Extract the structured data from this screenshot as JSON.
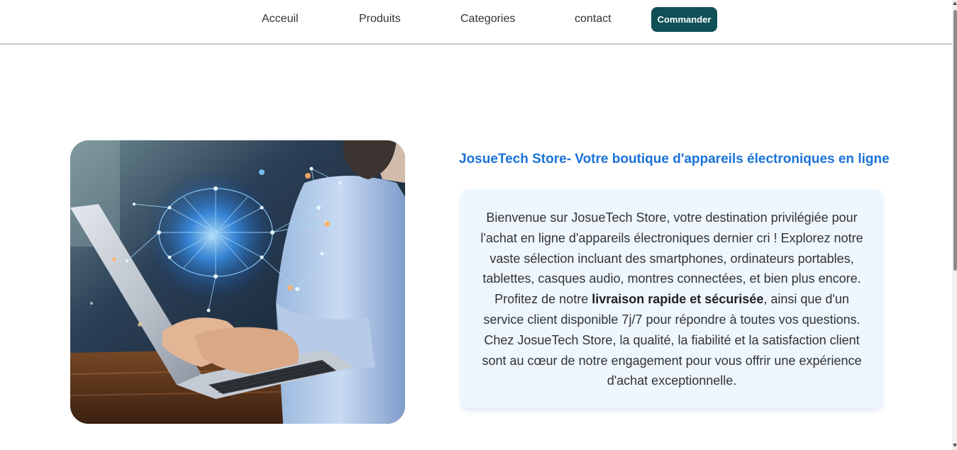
{
  "nav": {
    "items": [
      {
        "label": "Acceuil",
        "name": "nav-link-acceuil"
      },
      {
        "label": "Produits",
        "name": "nav-link-produits"
      },
      {
        "label": "Categories",
        "name": "nav-link-categories"
      },
      {
        "label": "contact",
        "name": "nav-link-contact"
      }
    ],
    "order_button": "Commander"
  },
  "hero": {
    "image_icon": "laptop-ai-brain-network-photo"
  },
  "content": {
    "headline": "JosueTech Store- Votre boutique d'appareils électroniques en ligne",
    "desc_part1": "Bienvenue sur JosueTech Store, votre destination privilégiée pour l'achat en ligne d'appareils électroniques dernier cri ! Explorez notre vaste sélection incluant des smartphones, ordinateurs portables, tablettes, casques audio, montres connectées, et bien plus encore. Profitez de notre ",
    "desc_bold": "livraison rapide et sécurisée",
    "desc_part2": ", ainsi que d'un service client disponible 7j/7 pour répondre à toutes vos questions. Chez JosueTech Store, la qualité, la fiabilité et la satisfaction client sont au cœur de notre engagement pour vous offrir une expérience d'achat exceptionnelle."
  },
  "colors": {
    "accent": "#1a73d9",
    "button": "#0f4f56",
    "card_bg": "#eef6fe",
    "text": "#333333"
  }
}
